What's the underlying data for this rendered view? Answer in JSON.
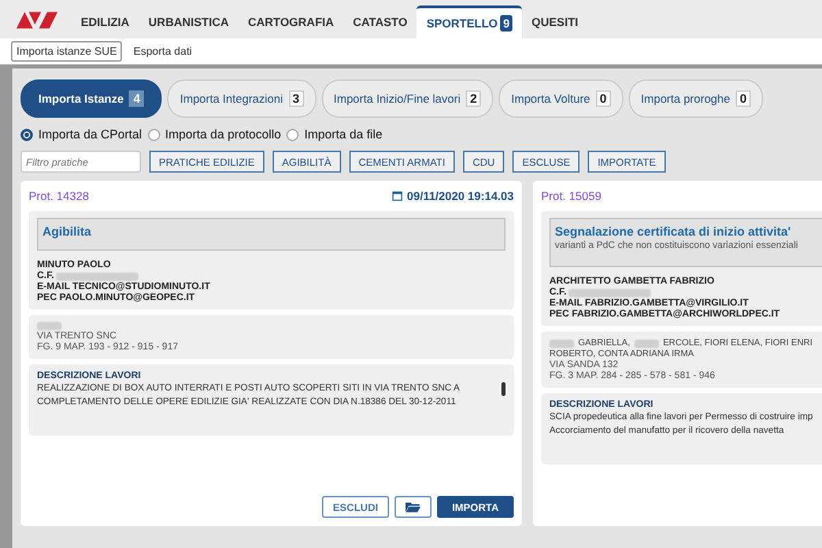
{
  "nav": {
    "tabs": [
      {
        "label": "EDILIZIA",
        "selected": false
      },
      {
        "label": "URBANISTICA",
        "selected": false
      },
      {
        "label": "CARTOGRAFIA",
        "selected": false
      },
      {
        "label": "CATASTO",
        "selected": false
      },
      {
        "label": "SPORTELLO",
        "badge": "9",
        "selected": true
      },
      {
        "label": "QUESITI",
        "selected": false
      }
    ]
  },
  "subnav": [
    {
      "label": "Importa istanze SUE",
      "selected": true
    },
    {
      "label": "Esporta dati",
      "selected": false
    }
  ],
  "pills": [
    {
      "label": "Importa Istanze",
      "count": "4",
      "selected": true
    },
    {
      "label": "Importa Integrazioni",
      "count": "3",
      "selected": false
    },
    {
      "label": "Importa Inizio/Fine lavori",
      "count": "2",
      "selected": false
    },
    {
      "label": "Importa Volture",
      "count": "0",
      "selected": false
    },
    {
      "label": "Importa proroghe",
      "count": "0",
      "selected": false
    }
  ],
  "sources": [
    {
      "label": "Importa da CPortal",
      "selected": true
    },
    {
      "label": "Importa da protocollo",
      "selected": false
    },
    {
      "label": "Importa da file",
      "selected": false
    }
  ],
  "filter": {
    "placeholder": "Filtro pratiche"
  },
  "filter_buttons": [
    "PRATICHE EDILIZIE",
    "AGIBILITÀ",
    "CEMENTI ARMATI",
    "CDU",
    "ESCLUSE",
    "IMPORTATE"
  ],
  "cards": [
    {
      "prot": "Prot. 14328",
      "date": "09/11/2020 19:14.03",
      "type": "Agibilita",
      "applicant": "MINUTO PAOLO",
      "cf_label": "C.F.",
      "email": "E-MAIL TECNICO@STUDIOMINUTO.IT",
      "pec": "PEC PAOLO.MINUTO@GEOPEC.IT",
      "owners": [
        [
          {
            "kind": "redacted"
          }
        ]
      ],
      "address": "VIA TRENTO SNC",
      "parcels": "FG. 9 MAP. 193 - 912 - 915 - 917",
      "desc_title": "DESCRIZIONE LAVORI",
      "desc": [
        "REALIZZAZIONE DI BOX AUTO INTERRATI E POSTI AUTO SCOPERTI SITI IN VIA TRENTO SNC A COMPLETAMENTO DELLE OPERE EDILIZIE GIA' REALIZZATE CON DIA N.18386 DEL 30-12-2011"
      ],
      "desc_scroll": true,
      "actions": [
        {
          "label": "ESCLUDI",
          "kind": "outline"
        },
        {
          "kind": "folder"
        },
        {
          "label": "IMPORTA",
          "kind": "primary"
        }
      ]
    },
    {
      "prot": "Prot. 15059",
      "type": "Segnalazione certificata di inizio attivita'",
      "subtype": "varianti a PdC che non costituiscono variazioni essenziali",
      "applicant": "ARCHITETTO GAMBETTA FABRIZIO",
      "cf_label": "C.F.",
      "email": "E-MAIL FABRIZIO.GAMBETTA@VIRGILIO.IT",
      "pec": "PEC FABRIZIO.GAMBETTA@ARCHIWORLDPEC.IT",
      "owners": [
        [
          {
            "kind": "redacted"
          },
          {
            "kind": "text",
            "text": "GABRIELLA,"
          },
          {
            "kind": "redacted"
          },
          {
            "kind": "text",
            "text": "ERCOLE, FIORI ELENA, FIORI ENRI"
          }
        ],
        [
          {
            "kind": "text",
            "text": "ROBERTO, CONTA ADRIANA IRMA"
          }
        ]
      ],
      "address": "VIA SANDA 132",
      "parcels": "FG. 3 MAP. 284 - 285 - 578 - 581 - 946",
      "desc_title": "DESCRIZIONE LAVORI",
      "desc": [
        "SCIA propedeutica alla fine lavori per Permesso di costruire imp",
        "Accorciamento del manufatto per il ricovero della navetta"
      ]
    }
  ]
}
